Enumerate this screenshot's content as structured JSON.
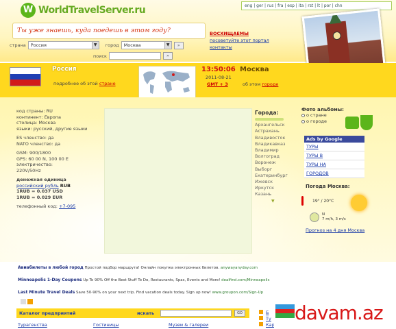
{
  "header": {
    "logo_mark": "W",
    "logo_text": "WorldTravelServer.ru",
    "languages": "eng | ger | rus | fra | esp | ita | rst | lt | por | chn",
    "slogan": "Ты уже знаешь, куда поедешь в этом году?",
    "link_hot": "ВОСХИЩАЕМЫ",
    "link_sitemap": "посоветуйте этот портал",
    "link_contacts": "контакты",
    "search": {
      "country_label": "страна",
      "country_value": "Россия",
      "city_label": "город",
      "city_value": "Москва",
      "query_label": "поиск"
    }
  },
  "country": {
    "name": "Россия",
    "more_prefix": "подробнее об этой",
    "more_link": "стране",
    "flag_colors": [
      "#ffffff",
      "#1f3fb4",
      "#d21a1a"
    ]
  },
  "city": {
    "time": "13:50:06",
    "name": "Москва",
    "date": "2011-08-21",
    "gmt": "GMT + 3",
    "more_prefix": "об этом",
    "more_link": "городе"
  },
  "info": {
    "code": "код страны: RU",
    "continent": "континент: Европа",
    "capital": "столица: Москва",
    "languages": "языки: русский, другие языки",
    "eu": "ES членство: да",
    "nato": "NATO членство: да",
    "gsm": "GSM: 900/1800",
    "gps": "GPS: 60 00 N, 100 00 E",
    "electricity_label": "электричество:",
    "electricity": "220V/50Hz",
    "currency_hd": "денежная единица",
    "currency_link": "российский рубль",
    "currency_code": "RUB",
    "rate_usd": "1RUB = 0.037 USD",
    "rate_eur": "1RUB = 0.029 EUR",
    "phone_label": "телефонный код:",
    "phone_code": "+7-095"
  },
  "cities": {
    "heading": "Города:",
    "list": [
      "Архангельск",
      "Астрахань",
      "Владивосток",
      "Владикавказ",
      "Владимир",
      "Волгоград",
      "Воронеж",
      "Выборг",
      "Екатеринбург",
      "Ижевск",
      "Иркутск",
      "Казань"
    ]
  },
  "photo_albums": {
    "heading": "Фото альбомы:",
    "opt_country": "о стране",
    "opt_city": "о городе"
  },
  "ads_google": {
    "heading": "Ads by Google",
    "links": [
      "ТУРЫ",
      "ТУРЫ В",
      "ТУРЫ НА",
      "ГОРОДОВ"
    ]
  },
  "weather": {
    "heading": "Погода Москва:",
    "temp": "19° / 20°C",
    "wind_dir": "N",
    "wind_speed": "7 m/h, 3 m/s",
    "forecast": "Прогноз на 4 дня Москва"
  },
  "ad_strip": [
    {
      "title": "Авиабилеты в любой город",
      "text": "Простой подбор маршрута! Онлайн покупка электронных билетов.",
      "url": "anywayanyday.com"
    },
    {
      "title": "Minneapolis 1-Day Coupons",
      "text": "Up To 90% Off the Best Stuff To Do, Restaurants, Spas, Events and More!",
      "url": "dealfind.com/Minneapolis"
    },
    {
      "title": "Last Minute Travel Deals",
      "text": "Save 50-90% on your next trip. Find vacation deals today. Sign up now!",
      "url": "www.groupon.com/Sign-Up"
    }
  ],
  "catalog": {
    "title": "Каталог предприятий",
    "search": "искать",
    "go": "GO",
    "links": [
      "Турагенства",
      "Гостиницы",
      "Музеи & галереи"
    ]
  },
  "right_bottom": [
    "Б",
    "Ту",
    "Карта Москвы"
  ],
  "watermark": {
    "text": "davam.az",
    "flag_colors": [
      "#3399dd",
      "#dd2222",
      "#33aa44"
    ]
  }
}
